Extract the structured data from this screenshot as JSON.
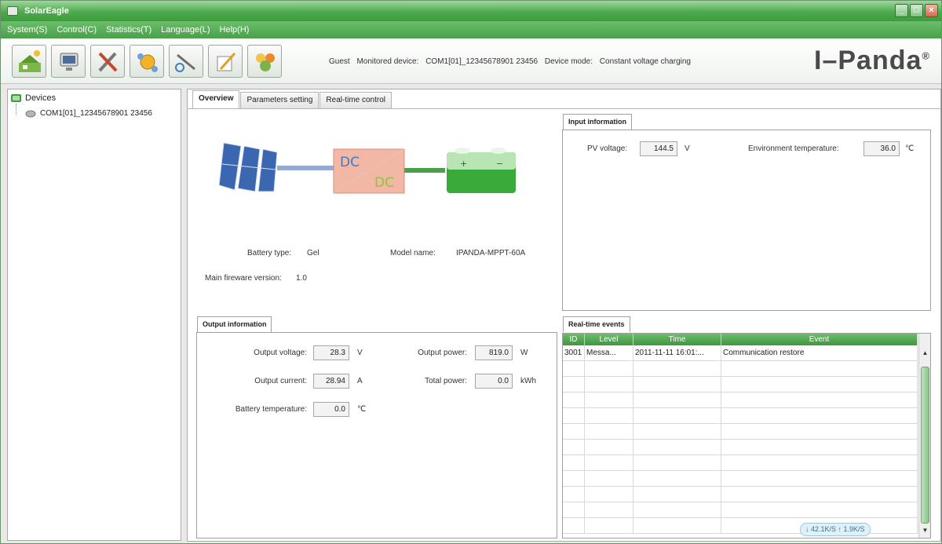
{
  "window": {
    "title": "SolarEagle",
    "controls": {
      "minimize": "_",
      "maximize": "□",
      "close": "×"
    }
  },
  "menu": [
    "System(S)",
    "Control(C)",
    "Statistics(T)",
    "Language(L)",
    "Help(H)"
  ],
  "toolbar": {
    "buttons": [
      "solar-station-icon",
      "monitor-device-icon",
      "tools-icon",
      "network-config-icon",
      "wrench-settings-icon",
      "edit-document-icon",
      "users-icon"
    ],
    "user": "Guest",
    "monitored_label": "Monitored device:",
    "monitored_value": "COM1[01]_12345678901 23456",
    "mode_label": "Device mode:",
    "mode_value": "Constant voltage charging",
    "brand": "I–Panda",
    "brand_mark": "®"
  },
  "sidebar": {
    "root": "Devices",
    "device": "COM1[01]_12345678901 23456"
  },
  "tabs": [
    "Overview",
    "Parameters setting",
    "Real-time control"
  ],
  "diagram": {
    "dc_top": "DC",
    "dc_bottom": "DC",
    "plus": "+",
    "minus": "−"
  },
  "overview": {
    "battery_type_label": "Battery type:",
    "battery_type_value": "Gel",
    "model_name_label": "Model name:",
    "model_name_value": "IPANDA-MPPT-60A",
    "firmware_label": "Main fireware version:",
    "firmware_value": "1.0"
  },
  "input": {
    "title": "Input information",
    "pv_voltage_label": "PV voltage:",
    "pv_voltage_value": "144.5",
    "pv_voltage_unit": "V",
    "env_temp_label": "Environment temperature:",
    "env_temp_value": "36.0",
    "env_temp_unit": "℃"
  },
  "output": {
    "title": "Output information",
    "voltage_label": "Output voltage:",
    "voltage_value": "28.3",
    "voltage_unit": "V",
    "current_label": "Output current:",
    "current_value": "28.94",
    "current_unit": "A",
    "battery_temp_label": "Battery temperature:",
    "battery_temp_value": "0.0",
    "battery_temp_unit": "℃",
    "power_label": "Output power:",
    "power_value": "819.0",
    "power_unit": "W",
    "total_power_label": "Total power:",
    "total_power_value": "0.0",
    "total_power_unit": "kWh"
  },
  "events": {
    "title": "Real-time events",
    "columns": [
      "ID",
      "Level",
      "Time",
      "Event"
    ],
    "rows": [
      {
        "id": "3001",
        "level": "Messa...",
        "time": "2011-11-11 16:01:...",
        "event": "Communication restore"
      }
    ],
    "network": "↓ 42.1K/S  ↑ 1.9K/S"
  }
}
